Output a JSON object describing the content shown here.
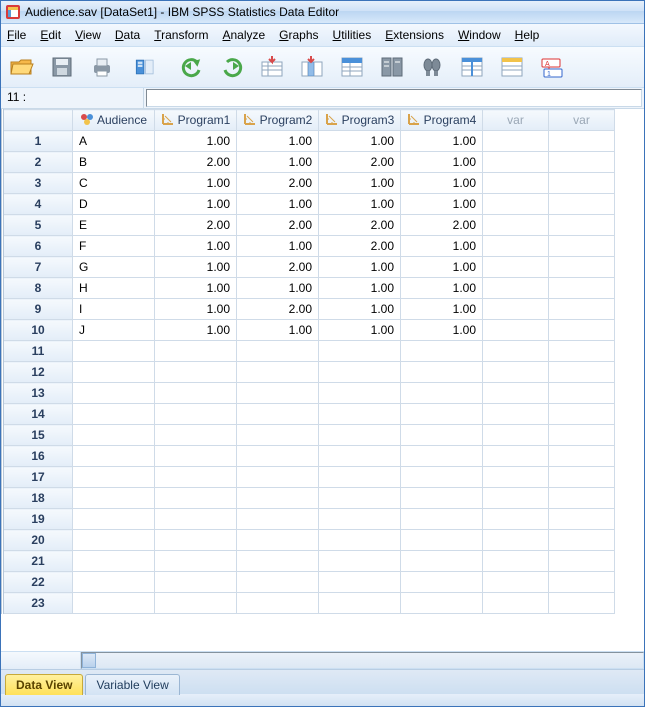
{
  "window": {
    "title": "Audience.sav [DataSet1] - IBM SPSS Statistics Data Editor"
  },
  "menus": [
    "File",
    "Edit",
    "View",
    "Data",
    "Transform",
    "Analyze",
    "Graphs",
    "Utilities",
    "Extensions",
    "Window",
    "Help"
  ],
  "cell_ref": {
    "label": "11 :",
    "value": ""
  },
  "columns": [
    {
      "name": "Audience",
      "type": "nominal"
    },
    {
      "name": "Program1",
      "type": "scale"
    },
    {
      "name": "Program2",
      "type": "scale"
    },
    {
      "name": "Program3",
      "type": "scale"
    },
    {
      "name": "Program4",
      "type": "scale"
    }
  ],
  "extra_var_header": "var",
  "rows": [
    {
      "n": 1,
      "Audience": "A",
      "Program1": "1.00",
      "Program2": "1.00",
      "Program3": "1.00",
      "Program4": "1.00"
    },
    {
      "n": 2,
      "Audience": "B",
      "Program1": "2.00",
      "Program2": "1.00",
      "Program3": "2.00",
      "Program4": "1.00"
    },
    {
      "n": 3,
      "Audience": "C",
      "Program1": "1.00",
      "Program2": "2.00",
      "Program3": "1.00",
      "Program4": "1.00"
    },
    {
      "n": 4,
      "Audience": "D",
      "Program1": "1.00",
      "Program2": "1.00",
      "Program3": "1.00",
      "Program4": "1.00"
    },
    {
      "n": 5,
      "Audience": "E",
      "Program1": "2.00",
      "Program2": "2.00",
      "Program3": "2.00",
      "Program4": "2.00"
    },
    {
      "n": 6,
      "Audience": "F",
      "Program1": "1.00",
      "Program2": "1.00",
      "Program3": "2.00",
      "Program4": "1.00"
    },
    {
      "n": 7,
      "Audience": "G",
      "Program1": "1.00",
      "Program2": "2.00",
      "Program3": "1.00",
      "Program4": "1.00"
    },
    {
      "n": 8,
      "Audience": "H",
      "Program1": "1.00",
      "Program2": "1.00",
      "Program3": "1.00",
      "Program4": "1.00"
    },
    {
      "n": 9,
      "Audience": "I",
      "Program1": "1.00",
      "Program2": "2.00",
      "Program3": "1.00",
      "Program4": "1.00"
    },
    {
      "n": 10,
      "Audience": "J",
      "Program1": "1.00",
      "Program2": "1.00",
      "Program3": "1.00",
      "Program4": "1.00"
    }
  ],
  "empty_row_count": 13,
  "tabs": {
    "data_view": "Data View",
    "variable_view": "Variable View",
    "active": "data_view"
  }
}
